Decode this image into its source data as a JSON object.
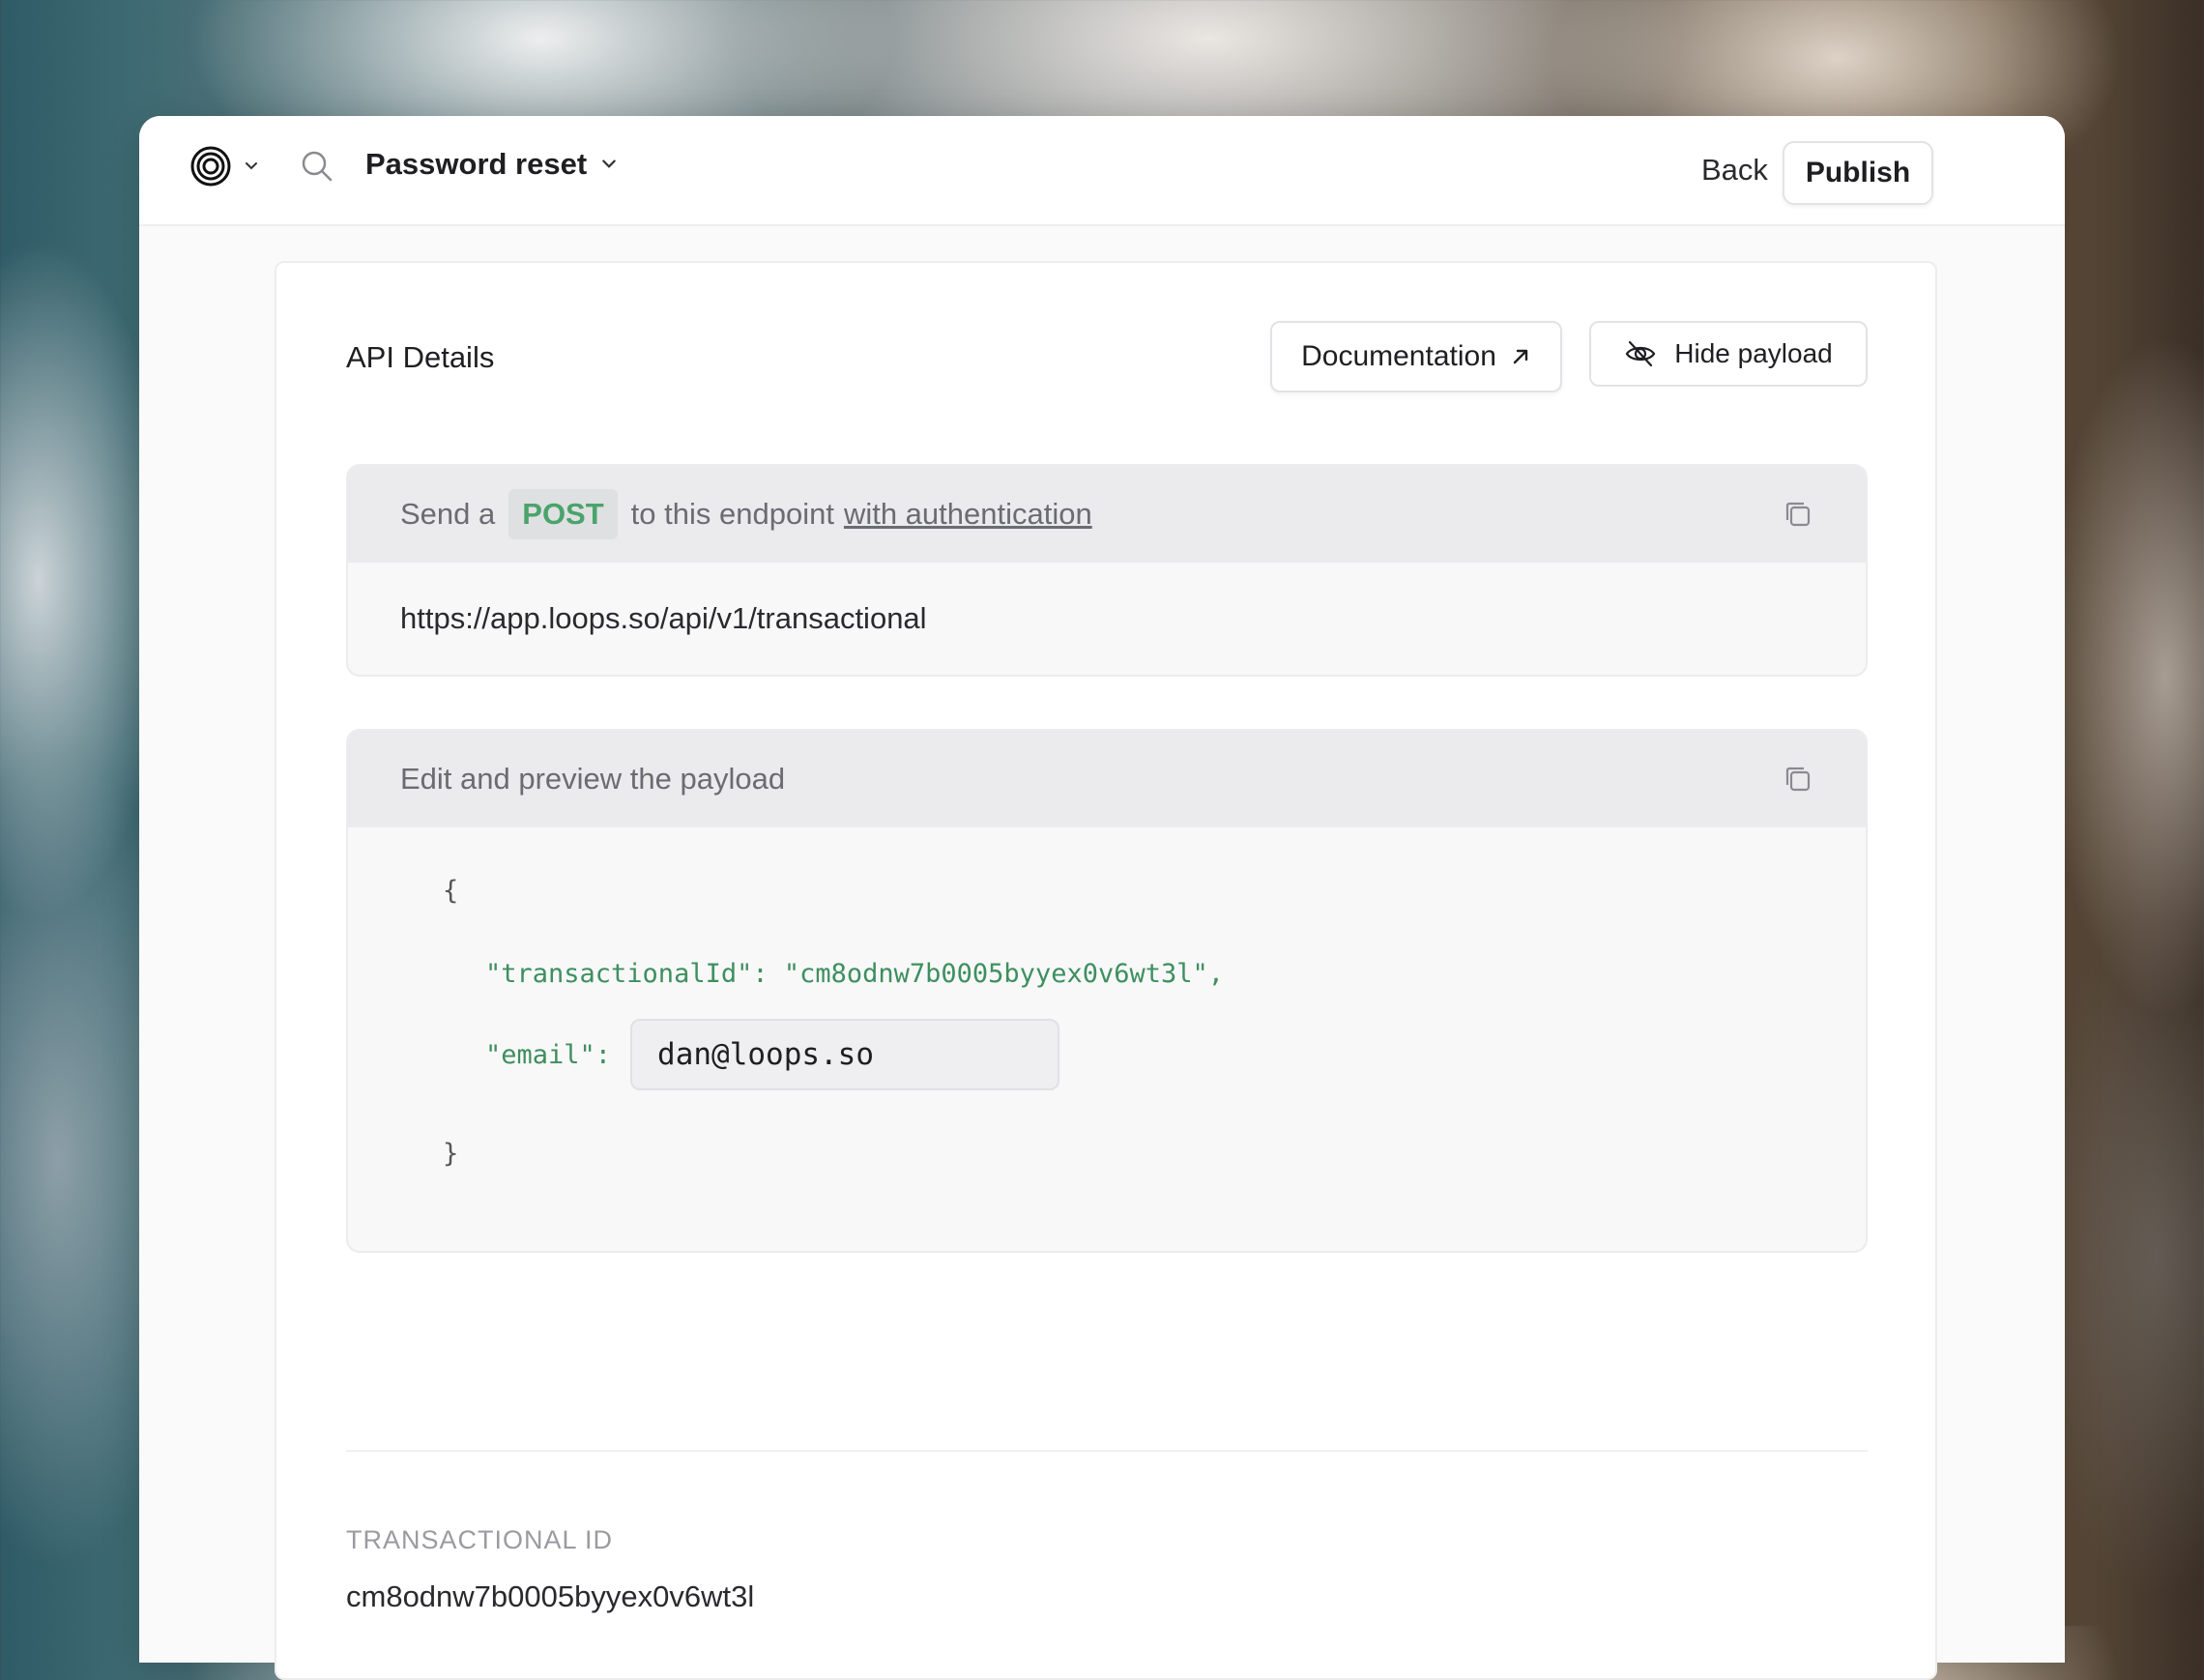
{
  "header": {
    "logo_icon": "loops-rings-icon",
    "search_icon": "search-icon",
    "page_title": "Password reset",
    "back_label": "Back",
    "publish_label": "Publish"
  },
  "api_details": {
    "title": "API Details",
    "documentation_label": "Documentation",
    "hide_payload_label": "Hide payload",
    "endpoint_panel": {
      "prefix": "Send a",
      "method": "POST",
      "middle": "to this endpoint",
      "auth_link": "with authentication",
      "url": "https://app.loops.so/api/v1/transactional"
    },
    "payload_panel": {
      "title": "Edit and preview the payload",
      "open_brace": "{",
      "transactional_line": "\"transactionalId\": \"cm8odnw7b0005byyex0v6wt3l\",",
      "email_key": "\"email\":",
      "email_value": "dan@loops.so",
      "close_brace": "}"
    },
    "transactional_id_label": "TRANSACTIONAL ID",
    "transactional_id_value": "cm8odnw7b0005byyex0v6wt3l"
  },
  "colors": {
    "accent_green": "#4aa36c",
    "text_dark": "#1f1f22",
    "muted": "#6b6b72"
  }
}
